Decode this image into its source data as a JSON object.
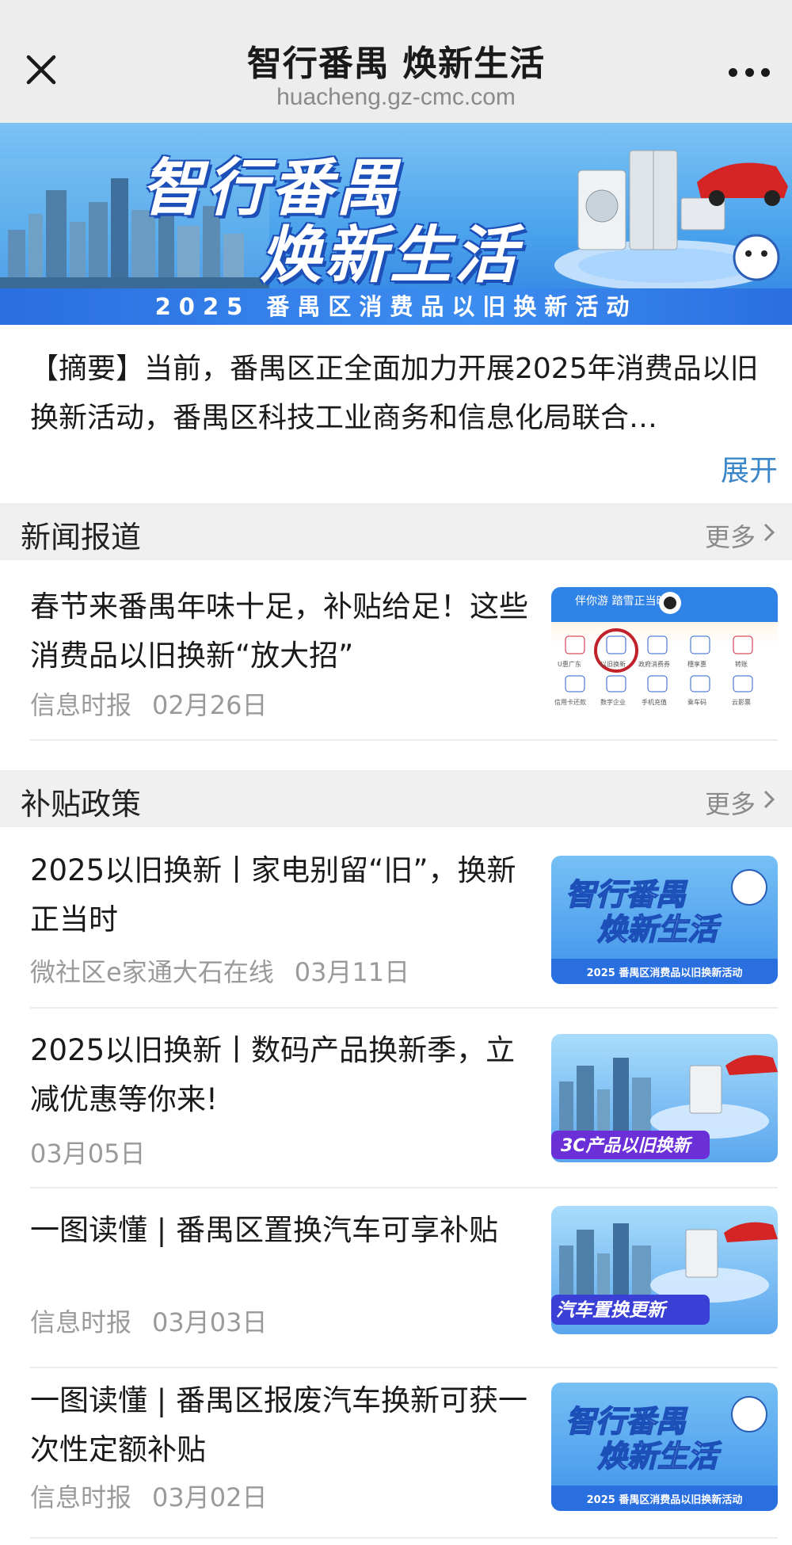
{
  "nav": {
    "title": "智行番禺 焕新生活",
    "url": "huacheng.gz-cmc.com"
  },
  "banner": {
    "title_line1": "智行番禺",
    "title_line2": "焕新生活",
    "subtitle": "2025 番禺区消费品以旧换新活动"
  },
  "summary": {
    "text": "【摘要】当前，番禺区正全面加力开展2025年消费品以旧换新活动，番禺区科技工业商务和信息化局联合…",
    "expand_label": "展开"
  },
  "sections": [
    {
      "label": "新闻报道",
      "more_label": "更多",
      "articles": [
        {
          "title": "春节来番禺年味十足，补贴给足！这些消费品以旧换新“放大招”",
          "source": "信息时报",
          "date": "02月26日",
          "thumb": "app-screenshot-thumb"
        }
      ]
    },
    {
      "label": "补贴政策",
      "more_label": "更多",
      "articles": [
        {
          "title": "2025以旧换新丨家电别留“旧”，换新正当时",
          "source": "微社区e家通大石在线",
          "date": "03月11日",
          "thumb": "campaign-poster-thumb"
        },
        {
          "title": "2025以旧换新丨数码产品换新季，立减优惠等你来!",
          "source": "",
          "date": "03月05日",
          "thumb": "3c-trade-in-thumb",
          "thumb_caption": "3C产品以旧换新"
        },
        {
          "title": "一图读懂 | 番禺区置换汽车可享补贴",
          "source": "信息时报",
          "date": "03月03日",
          "thumb": "car-replacement-thumb",
          "thumb_caption": "汽车置换更新"
        },
        {
          "title": "一图读懂 | 番禺区报废汽车换新可获一次性定额补贴",
          "source": "信息时报",
          "date": "03月02日",
          "thumb": "campaign-poster-thumb"
        }
      ]
    }
  ],
  "thumb_texts": {
    "app_header": "伴你游 踏雪正当时",
    "app_icons": [
      "U惠广东",
      "以旧换新",
      "政府消费券",
      "穗享惠",
      "转账",
      "信用卡还款",
      "数字企业",
      "手机充值",
      "乘车码",
      "云影票"
    ],
    "poster_line1": "智行番禺",
    "poster_line2": "焕新生活",
    "poster_sub": "2025 番禺区消费品以旧换新活动"
  },
  "colors": {
    "nav_bg": "#ededed",
    "section_bg": "#f0f0f0",
    "link_blue": "#3a86c8",
    "meta_gray": "#9a9a9a",
    "banner_blue": "#2f7fe0"
  }
}
